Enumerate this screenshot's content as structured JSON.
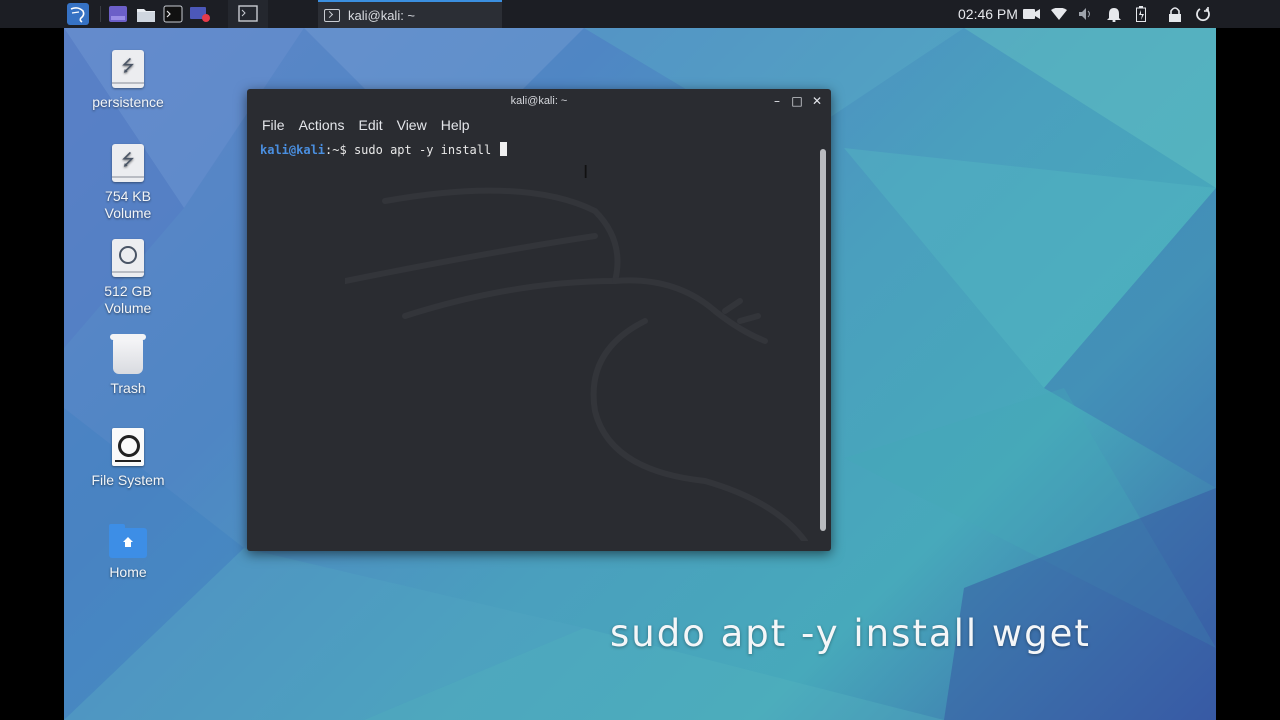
{
  "panel": {
    "launcher_icon": "kali-dragon-icon",
    "quicklaunch": [
      {
        "name": "workspace-switcher-icon"
      },
      {
        "name": "file-manager-icon"
      },
      {
        "name": "terminal-icon"
      },
      {
        "name": "screen-recorder-icon"
      }
    ],
    "taskbar": {
      "title": "kali@kali: ~"
    },
    "clock": "02:46 PM",
    "tray_icons": [
      "camera-icon",
      "wifi-icon",
      "volume-icon",
      "bell-icon",
      "battery-icon",
      "lock-icon",
      "power-icon"
    ]
  },
  "desktop_icons": [
    {
      "label_line1": "persistence",
      "label_line2": "",
      "icon": "usb-drive-icon"
    },
    {
      "label_line1": "754 KB",
      "label_line2": "Volume",
      "icon": "usb-drive-icon"
    },
    {
      "label_line1": "512 GB",
      "label_line2": "Volume",
      "icon": "disk-volume-icon"
    },
    {
      "label_line1": "Trash",
      "label_line2": "",
      "icon": "trash-icon"
    },
    {
      "label_line1": "File System",
      "label_line2": "",
      "icon": "filesystem-icon"
    },
    {
      "label_line1": "Home",
      "label_line2": "",
      "icon": "home-folder-icon"
    }
  ],
  "terminal": {
    "title": "kali@kali: ~",
    "controls": {
      "minimize": "–",
      "maximize": "□",
      "close": "✕"
    },
    "menu": [
      "File",
      "Actions",
      "Edit",
      "View",
      "Help"
    ],
    "prompt_user": "kali@kali",
    "prompt_path": ":~$",
    "command": " sudo apt -y install "
  },
  "caption": "sudo apt -y install wget",
  "colors": {
    "panel": "#1c1e24",
    "accent": "#3b8fe0",
    "terminal_bg": "#2a2c31",
    "prompt": "#4a8fe0"
  }
}
